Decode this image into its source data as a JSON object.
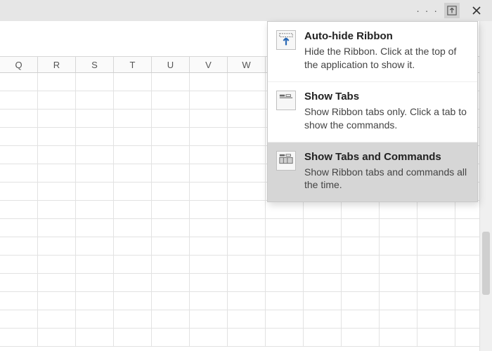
{
  "titlebar": {
    "ellipsis": "· · ·"
  },
  "columns": [
    "Q",
    "R",
    "S",
    "T",
    "U",
    "V",
    "W"
  ],
  "menu": {
    "items": [
      {
        "title": "Auto-hide Ribbon",
        "desc": "Hide the Ribbon. Click at the top of the application to show it.",
        "selected": false
      },
      {
        "title": "Show Tabs",
        "desc": "Show Ribbon tabs only. Click a tab to show the commands.",
        "selected": false
      },
      {
        "title": "Show Tabs and Commands",
        "desc": "Show Ribbon tabs and commands all the time.",
        "selected": true
      }
    ]
  }
}
